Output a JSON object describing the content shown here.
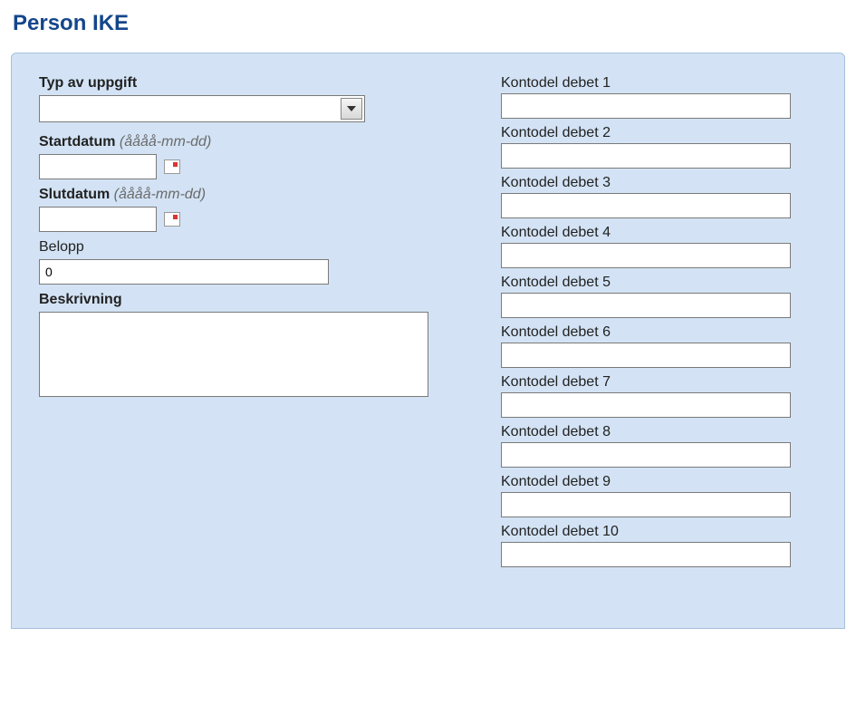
{
  "title": "Person IKE",
  "left": {
    "typ_label": "Typ av uppgift",
    "typ_value": "",
    "startdatum_label": "Startdatum",
    "startdatum_hint": "(åååå-mm-dd)",
    "startdatum_value": "",
    "slutdatum_label": "Slutdatum",
    "slutdatum_hint": "(åååå-mm-dd)",
    "slutdatum_value": "",
    "belopp_label": "Belopp",
    "belopp_value": "0",
    "beskrivning_label": "Beskrivning",
    "beskrivning_value": ""
  },
  "right": {
    "kontodel": [
      {
        "label": "Kontodel debet 1",
        "value": ""
      },
      {
        "label": "Kontodel debet 2",
        "value": ""
      },
      {
        "label": "Kontodel debet 3",
        "value": ""
      },
      {
        "label": "Kontodel debet 4",
        "value": ""
      },
      {
        "label": "Kontodel debet 5",
        "value": ""
      },
      {
        "label": "Kontodel debet 6",
        "value": ""
      },
      {
        "label": "Kontodel debet 7",
        "value": ""
      },
      {
        "label": "Kontodel debet 8",
        "value": ""
      },
      {
        "label": "Kontodel debet 9",
        "value": ""
      },
      {
        "label": "Kontodel debet 10",
        "value": ""
      }
    ]
  }
}
